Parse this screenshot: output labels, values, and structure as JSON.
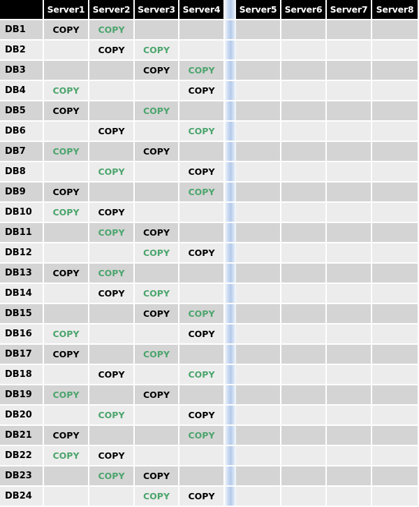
{
  "table": {
    "corner_label": "",
    "row_header_key": "database",
    "columns": [
      {
        "id": "server1",
        "label": "Server1"
      },
      {
        "id": "server2",
        "label": "Server2"
      },
      {
        "id": "server3",
        "label": "Server3"
      },
      {
        "id": "server4",
        "label": "Server4"
      },
      {
        "id": "divider",
        "label": "",
        "divider": true
      },
      {
        "id": "server5",
        "label": "Server5"
      },
      {
        "id": "server6",
        "label": "Server6"
      },
      {
        "id": "server7",
        "label": "Server7"
      },
      {
        "id": "server8",
        "label": "Server8"
      }
    ],
    "cell_value_label": "COPY",
    "colors": {
      "header_background": "#000000",
      "header_text": "#ffffff",
      "row_odd_background": "#d4d4d4",
      "row_even_background": "#ececec",
      "gridline": "#ffffff",
      "primary_copy_text": "#000000",
      "secondary_copy_text": "#4ca56d",
      "divider_gradient_start": "#f2f6fc",
      "divider_gradient_mid": "#b6cbea",
      "divider_gradient_end": "#f7fafd"
    },
    "rows": [
      {
        "label": "DB1",
        "cells": [
          "primary",
          "copy",
          "",
          "",
          "",
          "",
          "",
          "",
          ""
        ]
      },
      {
        "label": "DB2",
        "cells": [
          "",
          "primary",
          "copy",
          "",
          "",
          "",
          "",
          "",
          ""
        ]
      },
      {
        "label": "DB3",
        "cells": [
          "",
          "",
          "primary",
          "copy",
          "",
          "",
          "",
          "",
          ""
        ]
      },
      {
        "label": "DB4",
        "cells": [
          "copy",
          "",
          "",
          "primary",
          "",
          "",
          "",
          "",
          ""
        ]
      },
      {
        "label": "DB5",
        "cells": [
          "primary",
          "",
          "copy",
          "",
          "",
          "",
          "",
          "",
          ""
        ]
      },
      {
        "label": "DB6",
        "cells": [
          "",
          "primary",
          "",
          "copy",
          "",
          "",
          "",
          "",
          ""
        ]
      },
      {
        "label": "DB7",
        "cells": [
          "copy",
          "",
          "primary",
          "",
          "",
          "",
          "",
          "",
          ""
        ]
      },
      {
        "label": "DB8",
        "cells": [
          "",
          "copy",
          "",
          "primary",
          "",
          "",
          "",
          "",
          ""
        ]
      },
      {
        "label": "DB9",
        "cells": [
          "primary",
          "",
          "",
          "copy",
          "",
          "",
          "",
          "",
          ""
        ]
      },
      {
        "label": "DB10",
        "cells": [
          "copy",
          "primary",
          "",
          "",
          "",
          "",
          "",
          "",
          ""
        ]
      },
      {
        "label": "DB11",
        "cells": [
          "",
          "copy",
          "primary",
          "",
          "",
          "",
          "",
          "",
          ""
        ]
      },
      {
        "label": "DB12",
        "cells": [
          "",
          "",
          "copy",
          "primary",
          "",
          "",
          "",
          "",
          ""
        ]
      },
      {
        "label": "DB13",
        "cells": [
          "primary",
          "copy",
          "",
          "",
          "",
          "",
          "",
          "",
          ""
        ]
      },
      {
        "label": "DB14",
        "cells": [
          "",
          "primary",
          "copy",
          "",
          "",
          "",
          "",
          "",
          ""
        ]
      },
      {
        "label": "DB15",
        "cells": [
          "",
          "",
          "primary",
          "copy",
          "",
          "",
          "",
          "",
          ""
        ]
      },
      {
        "label": "DB16",
        "cells": [
          "copy",
          "",
          "",
          "primary",
          "",
          "",
          "",
          "",
          ""
        ]
      },
      {
        "label": "DB17",
        "cells": [
          "primary",
          "",
          "copy",
          "",
          "",
          "",
          "",
          "",
          ""
        ]
      },
      {
        "label": "DB18",
        "cells": [
          "",
          "primary",
          "",
          "copy",
          "",
          "",
          "",
          "",
          ""
        ]
      },
      {
        "label": "DB19",
        "cells": [
          "copy",
          "",
          "primary",
          "",
          "",
          "",
          "",
          "",
          ""
        ]
      },
      {
        "label": "DB20",
        "cells": [
          "",
          "copy",
          "",
          "primary",
          "",
          "",
          "",
          "",
          ""
        ]
      },
      {
        "label": "DB21",
        "cells": [
          "primary",
          "",
          "",
          "copy",
          "",
          "",
          "",
          "",
          ""
        ]
      },
      {
        "label": "DB22",
        "cells": [
          "copy",
          "primary",
          "",
          "",
          "",
          "",
          "",
          "",
          ""
        ]
      },
      {
        "label": "DB23",
        "cells": [
          "",
          "copy",
          "primary",
          "",
          "",
          "",
          "",
          "",
          ""
        ]
      },
      {
        "label": "DB24",
        "cells": [
          "",
          "",
          "copy",
          "primary",
          "",
          "",
          "",
          "",
          ""
        ]
      }
    ]
  }
}
